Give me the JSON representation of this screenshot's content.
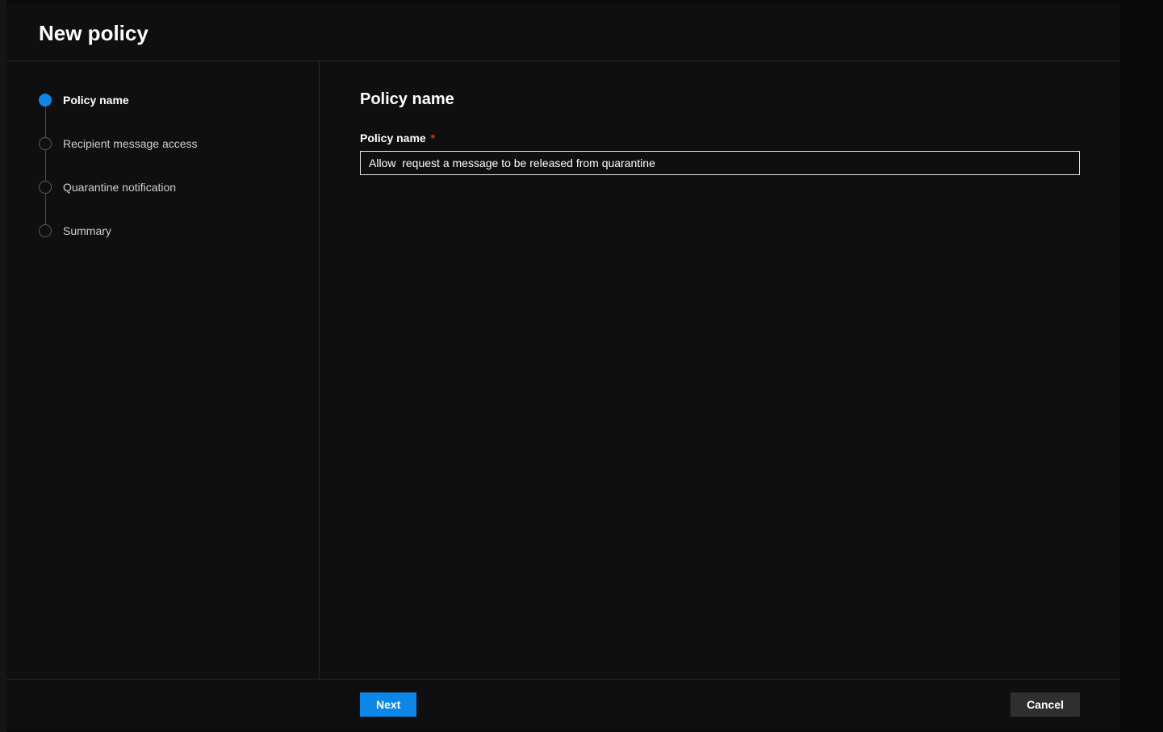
{
  "header": {
    "title": "New policy"
  },
  "steps": [
    {
      "label": "Policy name",
      "state": "active"
    },
    {
      "label": "Recipient message access",
      "state": "pending"
    },
    {
      "label": "Quarantine notification",
      "state": "pending"
    },
    {
      "label": "Summary",
      "state": "pending"
    }
  ],
  "main": {
    "section_title": "Policy name",
    "field_label": "Policy name",
    "required_marker": "*",
    "input_value": "Allow  request a message to be released from quarantine"
  },
  "footer": {
    "next_label": "Next",
    "cancel_label": "Cancel"
  }
}
